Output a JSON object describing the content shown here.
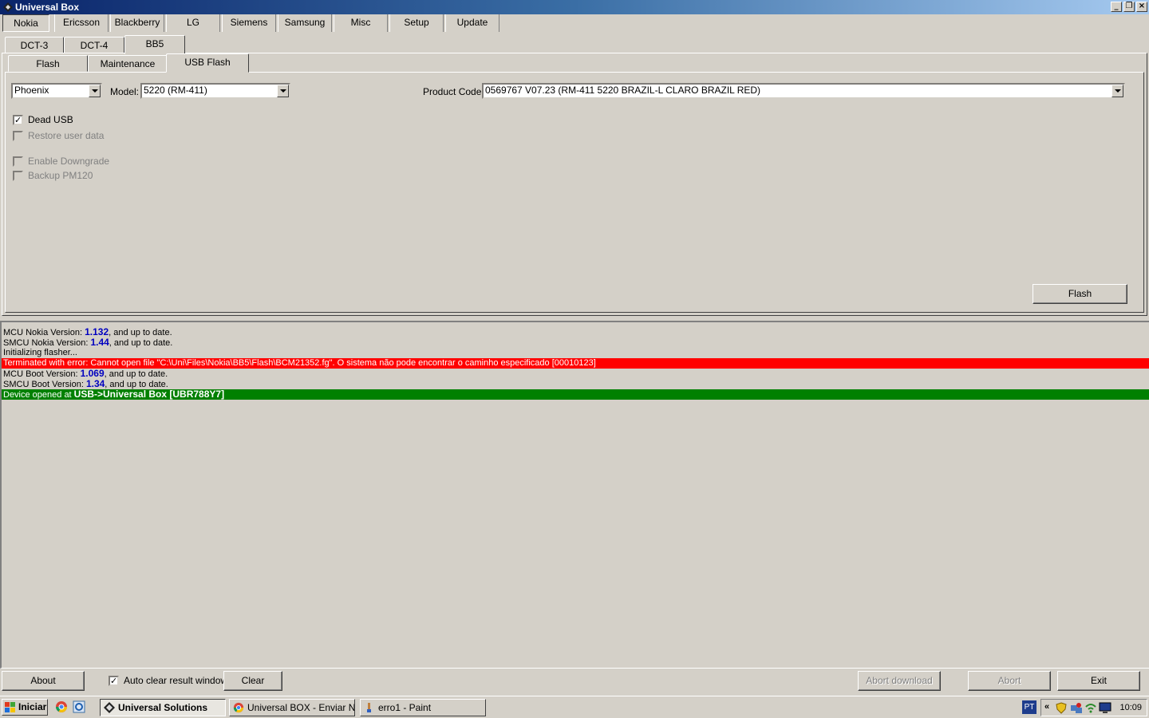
{
  "window": {
    "title": "Universal Box",
    "controls": [
      "_",
      "❐",
      "×"
    ]
  },
  "brand_tabs": [
    "Nokia",
    "Ericsson",
    "Blackberry",
    "LG",
    "Siemens",
    "Samsung",
    "Misc",
    "Setup",
    "Update"
  ],
  "platform_tabs": [
    "DCT-3",
    "DCT-4",
    "BB5"
  ],
  "function_tabs": [
    "Flash",
    "Maintenance",
    "USB Flash"
  ],
  "form": {
    "mode_value": "Phoenix",
    "model_label": "Model:",
    "model_value": "5220 (RM-411)",
    "product_code_label": "Product Code:",
    "product_code_value": "0569767 V07.23 (RM-411 5220 BRAZIL-L CLARO BRAZIL RED)",
    "dead_usb": {
      "label": "Dead USB",
      "checked": true
    },
    "restore_user_data": {
      "label": "Restore user data",
      "checked": false
    },
    "enable_downgrade": {
      "label": "Enable Downgrade",
      "checked": false
    },
    "backup_pm120": {
      "label": "Backup PM120",
      "checked": false
    },
    "flash_button": "Flash"
  },
  "log": {
    "l1_pre": "MCU Nokia Version: ",
    "l1_val": "1.132",
    "l1_post": ", and up to date.",
    "l2_pre": "SMCU Nokia Version: ",
    "l2_val": "1.44",
    "l2_post": ", and up to date.",
    "l3": "Initializing flasher...",
    "l4": "Terminated with error: Cannot open file \"C:\\Uni\\Files\\Nokia\\BB5\\Flash\\BCM21352.fg\". O sistema não pode encontrar o caminho especificado [00010123]",
    "l5_pre": "MCU Boot Version: ",
    "l5_val": "1.069",
    "l5_post": ", and up to date.",
    "l6_pre": "SMCU Boot Version: ",
    "l6_val": "1.34",
    "l6_post": ", and up to date.",
    "l7_pre": "Device opened at ",
    "l7_val": "USB->Universal Box [UBR788Y7]"
  },
  "bottom": {
    "about": "About",
    "auto_clear": {
      "label": "Auto clear result window",
      "checked": true
    },
    "clear": "Clear",
    "abort_download": "Abort download",
    "abort": "Abort",
    "exit": "Exit"
  },
  "taskbar": {
    "start": "Iniciar",
    "tasks": [
      "Universal Solutions",
      "Universal BOX - Enviar N...",
      "erro1 - Paint"
    ],
    "language": "PT",
    "chevron": "«",
    "clock": "10:09"
  },
  "colors": {
    "error_bg": "#ff0000",
    "success_bg": "#008000",
    "version_text": "#0000c0",
    "title_start": "#0a246a",
    "title_end": "#a6caf0"
  }
}
